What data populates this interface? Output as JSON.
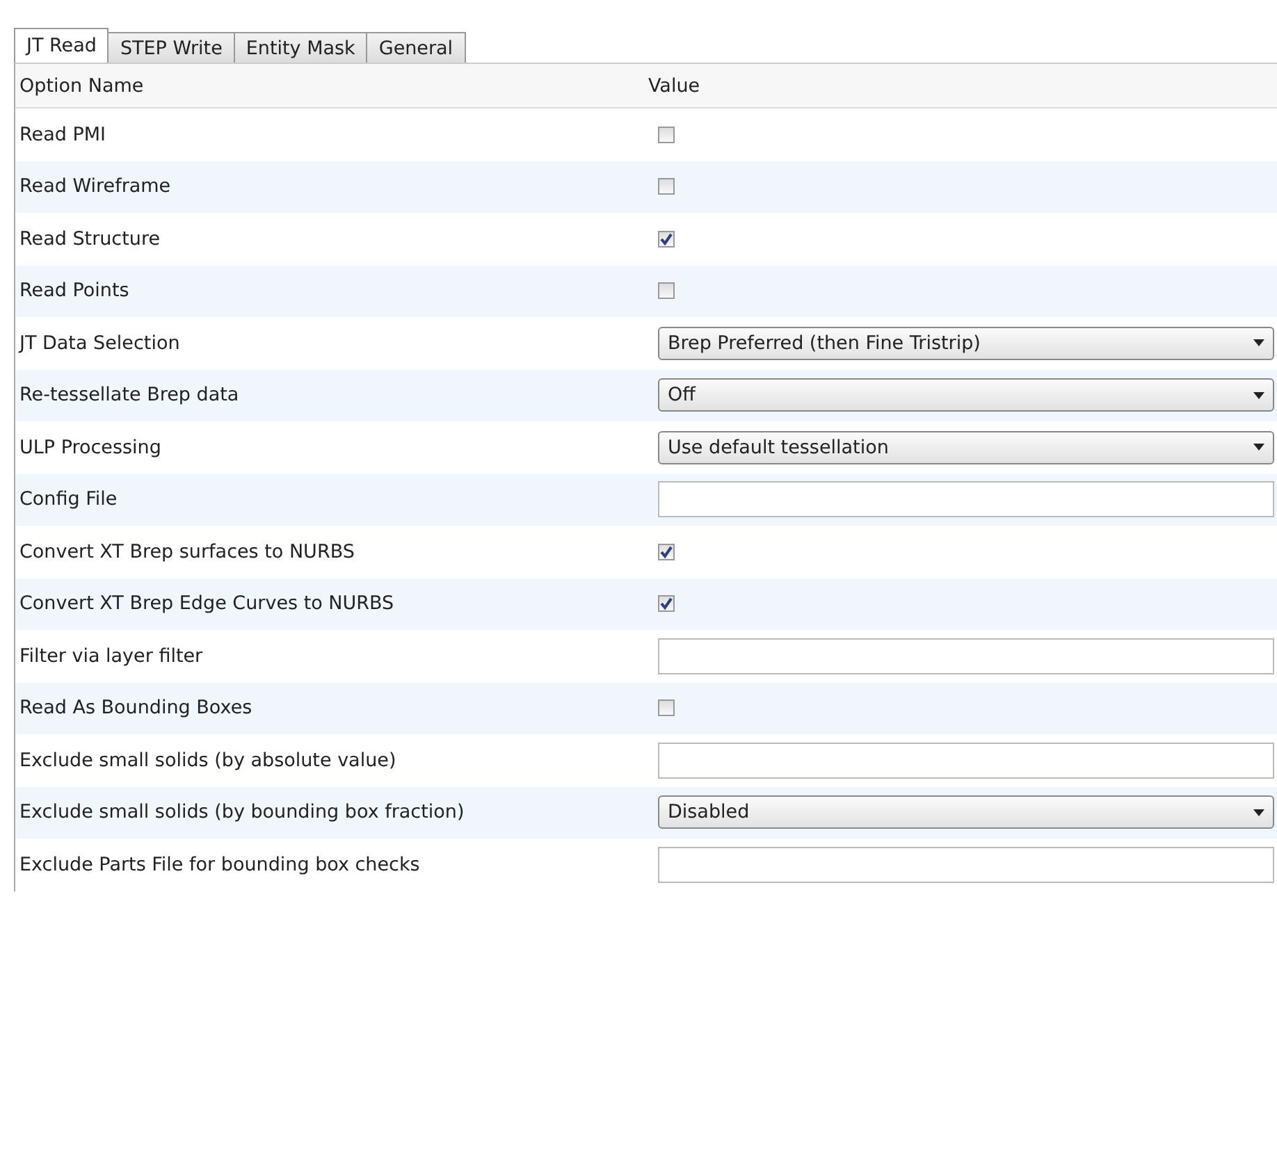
{
  "tabs": [
    {
      "label": "JT Read",
      "selected": true
    },
    {
      "label": "STEP Write",
      "selected": false
    },
    {
      "label": "Entity Mask",
      "selected": false
    },
    {
      "label": "General",
      "selected": false
    }
  ],
  "columns": [
    "Option Name",
    "Value"
  ],
  "rows": [
    {
      "name": "Read PMI",
      "kind": "checkbox",
      "checked": false
    },
    {
      "name": "Read Wireframe",
      "kind": "checkbox",
      "checked": false
    },
    {
      "name": "Read Structure",
      "kind": "checkbox",
      "checked": true
    },
    {
      "name": "Read Points",
      "kind": "checkbox",
      "checked": false
    },
    {
      "name": "JT Data Selection",
      "kind": "dropdown",
      "value": "Brep Preferred (then Fine Tristrip)"
    },
    {
      "name": "Re-tessellate Brep data",
      "kind": "dropdown",
      "value": "Off"
    },
    {
      "name": "ULP Processing",
      "kind": "dropdown",
      "value": "Use default tessellation"
    },
    {
      "name": "Config File",
      "kind": "file"
    },
    {
      "name": "Convert XT Brep surfaces to NURBS",
      "kind": "checkbox",
      "checked": true
    },
    {
      "name": "Convert XT Brep Edge Curves to NURBS",
      "kind": "checkbox",
      "checked": true
    },
    {
      "name": "Filter via layer filter",
      "kind": "text"
    },
    {
      "name": "Read As Bounding Boxes",
      "kind": "checkbox",
      "checked": false
    },
    {
      "name": "Exclude small solids (by absolute value)",
      "kind": "text"
    },
    {
      "name": "Exclude small solids (by bounding box fraction)",
      "kind": "dropdown",
      "value": "Disabled"
    },
    {
      "name": "Exclude Parts File for bounding box checks",
      "kind": "file"
    }
  ]
}
